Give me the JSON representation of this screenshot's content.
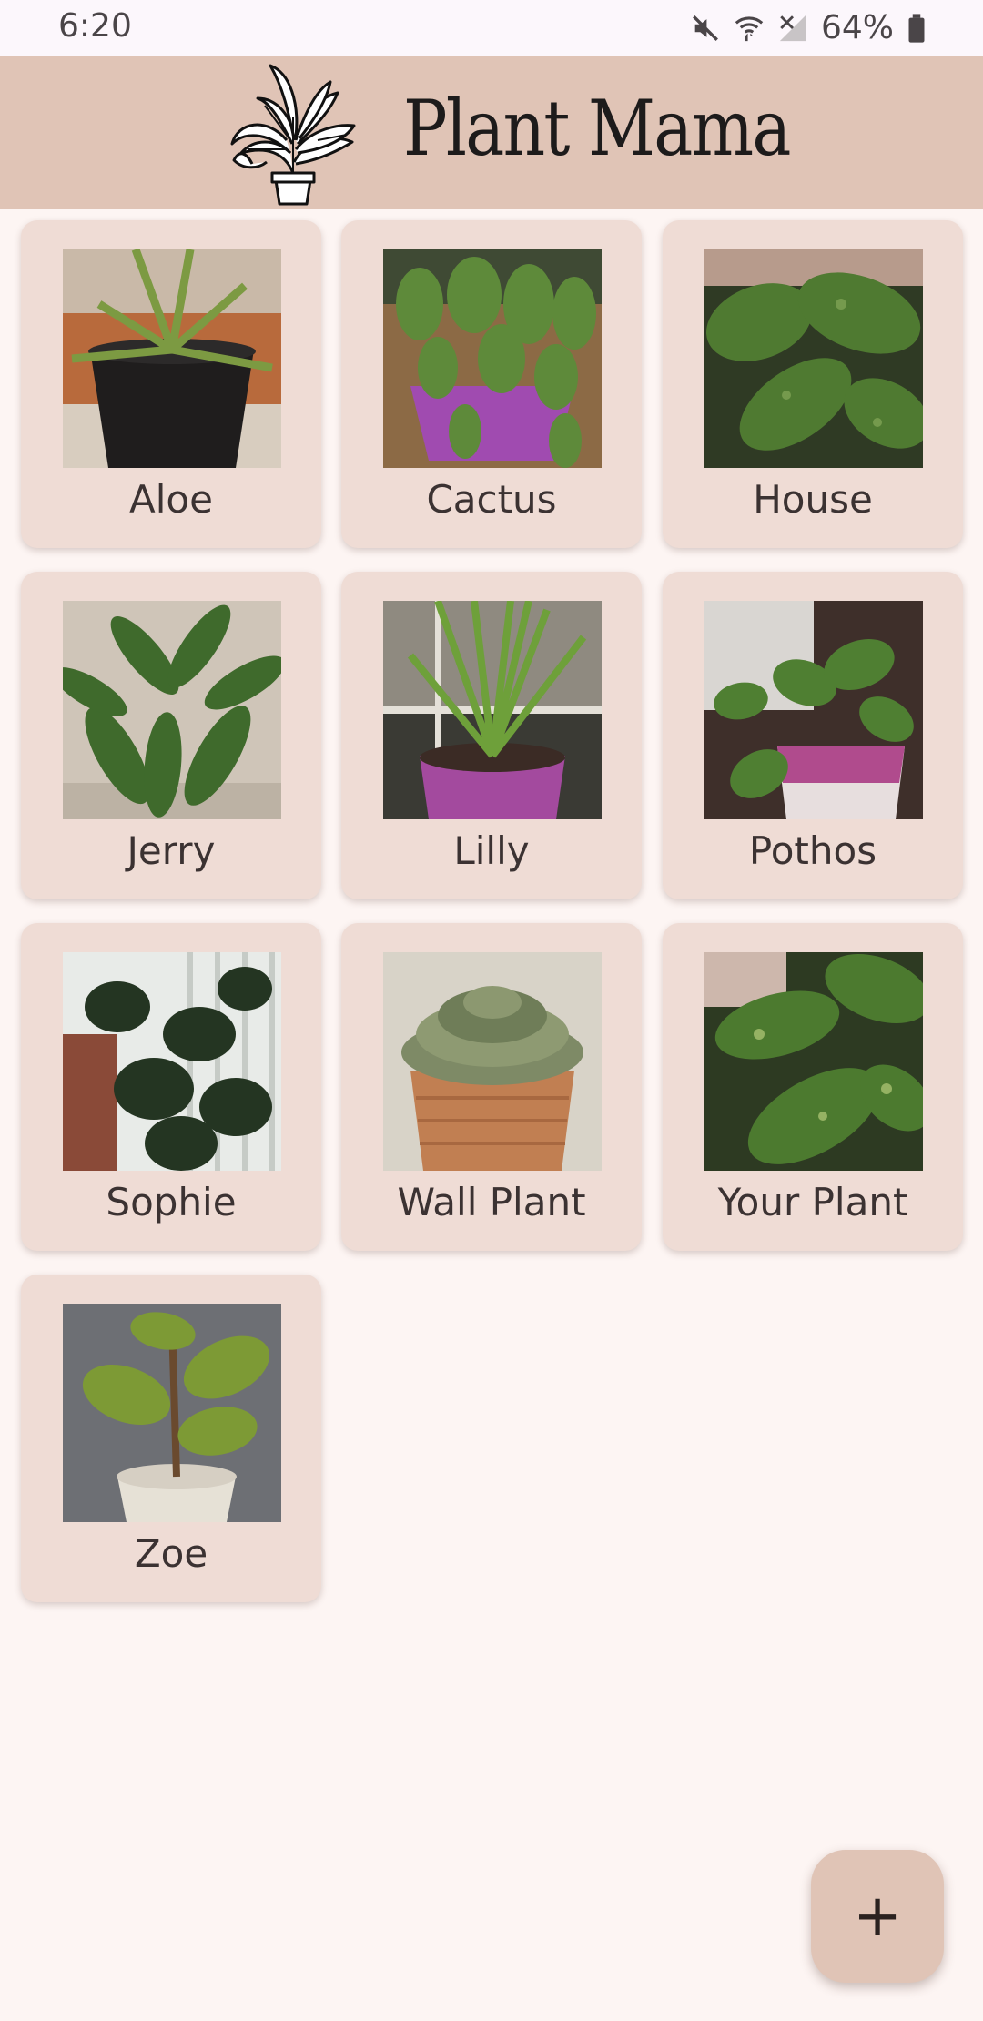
{
  "status_bar": {
    "time": "6:20",
    "battery": "64%",
    "icons": [
      "mute-icon",
      "wifi-icon",
      "no-signal-icon",
      "battery-icon"
    ]
  },
  "header": {
    "title": "Plant Mama",
    "logo_icon": "potted-plant-logo"
  },
  "plants": [
    {
      "name": "Aloe"
    },
    {
      "name": "Cactus"
    },
    {
      "name": "House"
    },
    {
      "name": "Jerry"
    },
    {
      "name": "Lilly"
    },
    {
      "name": "Pothos"
    },
    {
      "name": "Sophie"
    },
    {
      "name": "Wall Plant"
    },
    {
      "name": "Your Plant"
    },
    {
      "name": "Zoe"
    }
  ],
  "fab": {
    "label": "+",
    "icon": "add-icon"
  },
  "colors": {
    "header_bg": "#e0c4b6",
    "card_bg": "#efdcd5",
    "page_bg": "#fdf5f3"
  }
}
